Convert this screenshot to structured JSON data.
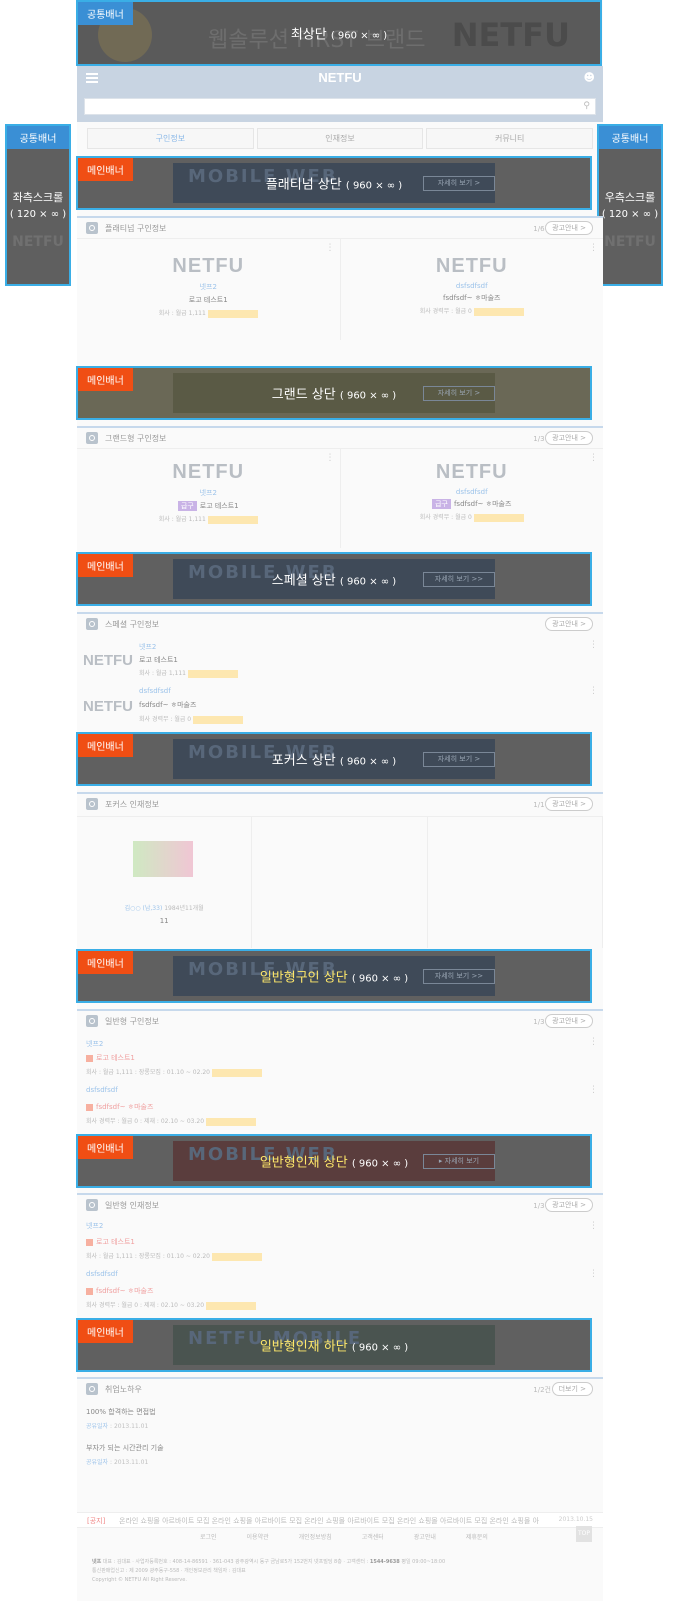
{
  "top_banner": {
    "tag": "공통배너",
    "title": "최상단",
    "size": "( 960 × ∞ )",
    "ghost_text": "웹솔루션 FIRST 브랜드",
    "ghost_brand": "NETFU"
  },
  "left_scroll": {
    "tag": "공통배너",
    "title": "좌측스크롤",
    "size": "( 120 × ∞ )",
    "ghost": "NETFU"
  },
  "right_scroll": {
    "tag": "공통배너",
    "title": "우측스크롤",
    "size": "( 120 × ∞ )",
    "ghost": "NETFU"
  },
  "header": {
    "logo": "NETFU",
    "user_icon": "user-icon",
    "menu_icon": "hamburger-icon",
    "search_placeholder": ""
  },
  "tabs": [
    {
      "label": "구인정보",
      "active": true
    },
    {
      "label": "인재정보",
      "active": false
    },
    {
      "label": "커뮤니티",
      "active": false
    }
  ],
  "banners": [
    {
      "tag": "메인배너",
      "title": "플래티넘 상단",
      "size": "( 960 × ∞ )",
      "ghost": "MOBILE WEB",
      "btn": "자세히 보기 >"
    },
    {
      "tag": "메인배너",
      "title": "그랜드 상단",
      "size": "( 960 × ∞ )",
      "ghost": "",
      "btn": "자세히 보기 >"
    },
    {
      "tag": "메인배너",
      "title": "스페셜 상단",
      "size": "( 960 × ∞ )",
      "ghost": "MOBILE WEB",
      "btn": "자세히 보기 >>"
    },
    {
      "tag": "메인배너",
      "title": "포커스 상단",
      "size": "( 960 × ∞ )",
      "ghost": "MOBILE WEB",
      "btn": "자세히 보기 >"
    },
    {
      "tag": "메인배너",
      "title": "일반형구인 상단",
      "size": "( 960 × ∞ )",
      "ghost": "MOBILE WEB",
      "btn": "자세히 보기 >>"
    },
    {
      "tag": "메인배너",
      "title": "일반형인재 상단",
      "size": "( 960 × ∞ )",
      "ghost": "MOBILE WEB",
      "btn": "▸ 자세히 보기"
    },
    {
      "tag": "메인배너",
      "title": "일반형인재 하단",
      "size": "( 960 × ∞ )",
      "ghost": "NETFU MOBILE",
      "btn": ""
    }
  ],
  "platinum": {
    "title": "플래티넘 구인정보",
    "count": "1/6건",
    "ad": "광고안내 >",
    "cards": [
      {
        "logo": "NETFU",
        "name": "넷프2",
        "title": "로고 테스트1",
        "pay": "회사 : 월급 1,111"
      },
      {
        "logo": "NETFU",
        "name": "dsfsdfsdf",
        "title": "fsdfsdf~ ㅎ마술즈",
        "pay": "회사 경력무 : 월급 0"
      }
    ]
  },
  "grand": {
    "title": "그랜드형 구인정보",
    "count": "1/3건",
    "ad": "광고안내 >",
    "cards": [
      {
        "logo": "NETFU",
        "name": "넷프2",
        "badge": "급구",
        "title": "로고 테스트1",
        "pay": "회사 : 월급 1,111"
      },
      {
        "logo": "NETFU",
        "name": "dsfsdfsdf",
        "badge": "급구",
        "title": "fsdfsdf~ ㅎ마술즈",
        "pay": "회사 경력무 : 월급 0"
      }
    ]
  },
  "special": {
    "title": "스페셜 구인정보",
    "ad": "광고안내 >",
    "rows": [
      {
        "logo": "NETFU",
        "name": "넷프2",
        "title": "로고 테스트1",
        "pay": "회사 : 월급 1,111"
      },
      {
        "logo": "NETFU",
        "name": "dsfsdfsdf",
        "title": "fsdfsdf~ ㅎ마술즈",
        "pay": "회사 경력무 : 월급 0"
      }
    ]
  },
  "focus": {
    "title": "포커스 인재정보",
    "count": "1/1건",
    "ad": "광고안내 >",
    "name": "김○○ (남,33)",
    "meta": "1984년11개월",
    "sub": "11"
  },
  "general_jobs": {
    "title": "일반형 구인정보",
    "count": "1/3건",
    "ad": "광고안내 >",
    "rows": [
      {
        "name": "넷프2",
        "title": "로고 테스트1",
        "pay": "회사 : 월급 1,111 : 장롱모집 : 01.10 ~ 02.20"
      },
      {
        "name": "dsfsdfsdf",
        "title": "fsdfsdf~ ㅎ마술즈",
        "pay": "회사 경력무 : 월급 0 : 제재 : 02.10 ~ 03.20"
      }
    ]
  },
  "general_talent": {
    "title": "일반형 인재정보",
    "count": "1/3건",
    "ad": "광고안내 >",
    "rows": [
      {
        "name": "넷프2",
        "title": "로고 테스트1",
        "pay": "회사 : 월급 1,111 : 장롱모집 : 01.10 ~ 02.20"
      },
      {
        "name": "dsfsdfsdf",
        "title": "fsdfsdf~ ㅎ마술즈",
        "pay": "회사 경력무 : 월급 0 : 제재 : 02.10 ~ 03.20"
      }
    ]
  },
  "knowhow": {
    "title": "취업노하우",
    "count": "1/2건",
    "ad": "더보기 >",
    "items": [
      {
        "title": "100% 합격하는 면접법",
        "label": "공유일자",
        "date": "2013.11.01"
      },
      {
        "title": "부자가 되는 시간관리 기술",
        "label": "공유일자",
        "date": "2013.11.01"
      }
    ]
  },
  "notice": {
    "key": "[공지]",
    "msg": "온라인 쇼핑몰 아르바이트 모집 온라인 쇼핑몰 아르바이트 모집 온라인 쇼핑몰 아르바이트 모집 온라인 쇼핑몰 아르바이트 모집 온라인 쇼핑몰 아르",
    "date": "2013.10.15"
  },
  "footer_nav": [
    "로그인",
    "이용약관",
    "개인정보방침",
    "고객센터",
    "광고안내",
    "제휴문의"
  ],
  "up": "TOP",
  "footer": {
    "line1_brand": "넷프",
    "line1": "대표 : 김대표 · 사업자등록번호 : 408-14-86591 · 361-043 광주광역시 동구 금남로5가 152번지 넷프빌딩 8층 · 고객센터 :",
    "phone": "1544-9638",
    "line1_tail": "평일 09:00~18:00",
    "line2": "통신판매업신고 : 제 2009 광주동구-558 · 개인정보관리 책임자 : 김대표",
    "line3": "Copyright © NETFU All Right Reserve."
  }
}
